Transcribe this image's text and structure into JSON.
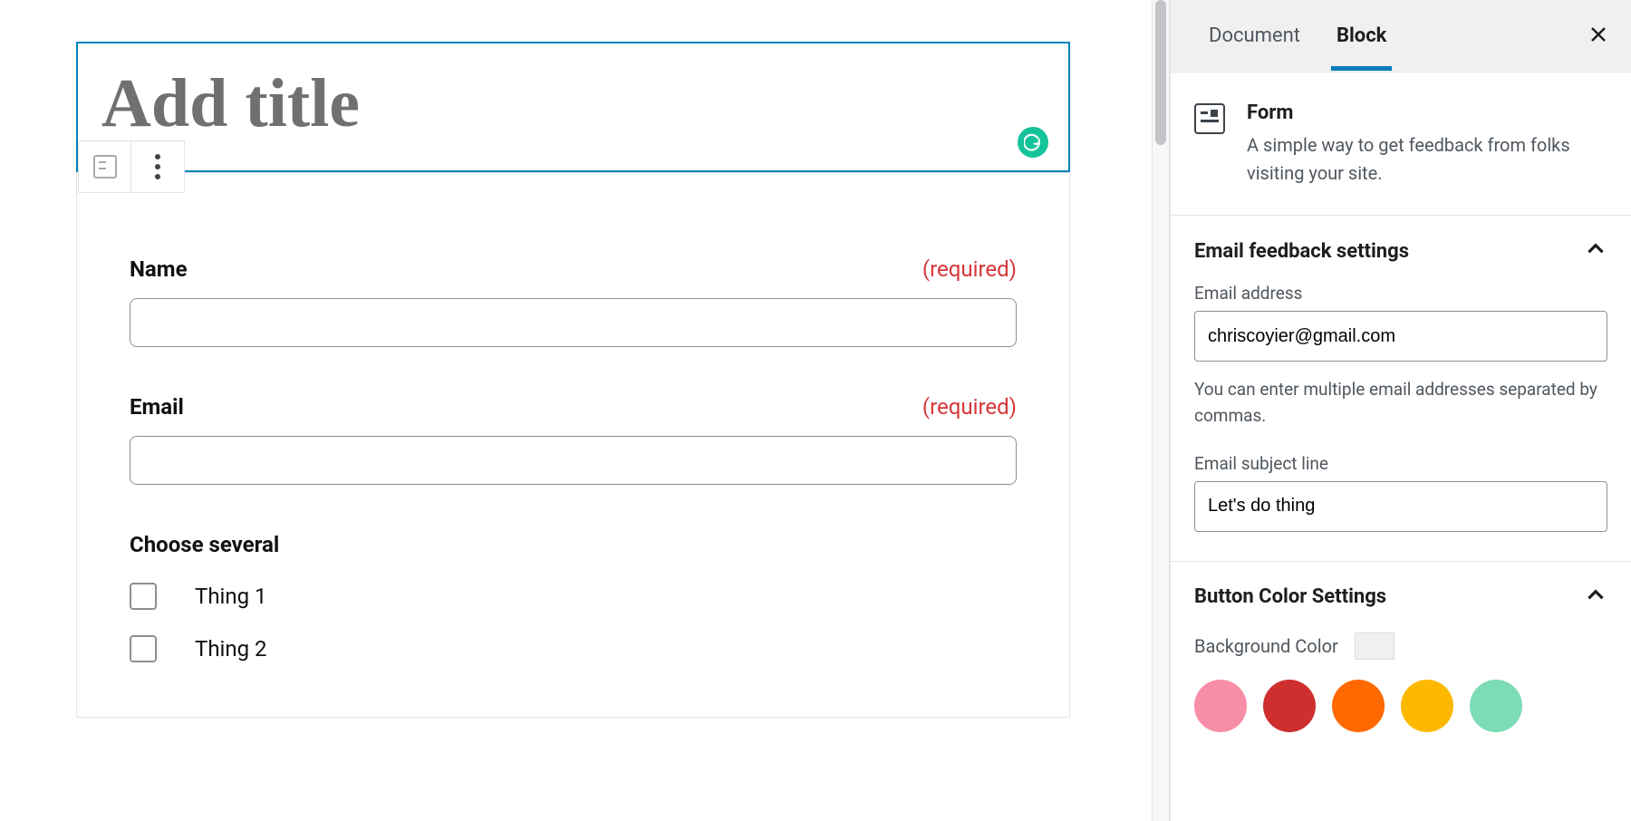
{
  "editor": {
    "titlePlaceholder": "Add title",
    "form": {
      "fields": [
        {
          "label": "Name",
          "required": "(required)"
        },
        {
          "label": "Email",
          "required": "(required)"
        }
      ],
      "checkboxGroup": {
        "label": "Choose several",
        "options": [
          "Thing 1",
          "Thing 2"
        ]
      }
    }
  },
  "sidebar": {
    "tabs": {
      "document": "Document",
      "block": "Block"
    },
    "blockInfo": {
      "title": "Form",
      "description": "A simple way to get feedback from folks visiting your site."
    },
    "emailPanel": {
      "title": "Email feedback settings",
      "addressLabel": "Email address",
      "addressValue": "chriscoyier@gmail.com",
      "addressHelp": "You can enter multiple email addresses separated by commas.",
      "subjectLabel": "Email subject line",
      "subjectValue": "Let's do thing"
    },
    "colorPanel": {
      "title": "Button Color Settings",
      "backgroundLabel": "Background Color",
      "swatches": [
        "#f78da7",
        "#cf2e2e",
        "#ff6900",
        "#fcb900",
        "#7bdcb5"
      ]
    }
  }
}
